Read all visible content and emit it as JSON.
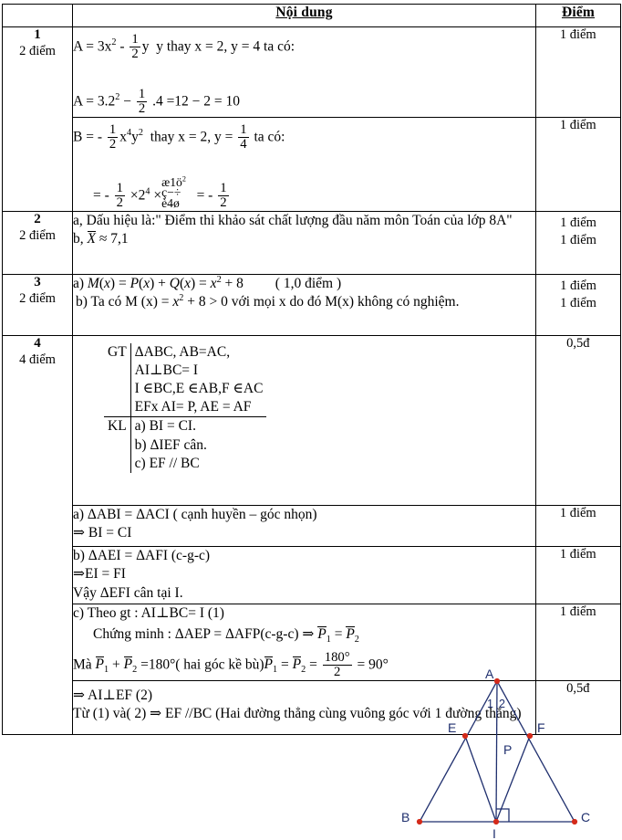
{
  "header": {
    "col_no": "",
    "col_content": "Nội dung",
    "col_points": "Điểm"
  },
  "rows": [
    {
      "no": "1",
      "no_points": "2 điểm",
      "parts": [
        {
          "lines": [
            "A = 3x² - ½ y  thay x = 2, y = 4 ta có:",
            "A = 3.2² − ½ .4 = 12 − 2 = 10"
          ],
          "points": "1 điểm"
        },
        {
          "lines": [
            "B = - ½ x⁴y²  thay x = 2, y = ¼ ta có:",
            "= - ½ ×2⁴ × (1/4)² = - ½"
          ],
          "points": "1 điểm"
        }
      ]
    },
    {
      "no": "2",
      "no_points": "2 điểm",
      "lines": [
        "a, Dấu hiệu là:\" Điểm thi khảo sát chất lượng đầu năm môn Toán của lớp 8A\"",
        "b, X̄ ≈ 7,1"
      ],
      "points": [
        "1 điểm",
        "1 điểm"
      ]
    },
    {
      "no": "3",
      "no_points": "2 điểm",
      "lines": [
        "a) M(x) = P(x) + Q(x) = x² + 8        ( 1,0 điểm )",
        "b) Ta có M (x) = x² + 8 > 0  với mọi x do đó M(x) không có nghiệm."
      ],
      "points": [
        "1 điểm",
        "1 điểm"
      ]
    },
    {
      "no": "4",
      "no_points": "4 điểm",
      "gtkl": {
        "gt_label": "GT",
        "kl_label": "KL",
        "gt_lines": [
          "ΔABC, AB=AC,",
          "AI⊥BC= I",
          "I ∈BC,E ∈AB,F ∈AC",
          "EFx AI= P, AE = AF"
        ],
        "kl_lines": [
          "a) BI = CI.",
          "b) ΔIEF cân.",
          "c) EF // BC"
        ]
      },
      "figure": {
        "labels": {
          "A": "A",
          "B": "B",
          "C": "C",
          "E": "E",
          "F": "F",
          "I": "I",
          "P": "P",
          "angle1": "1",
          "angle2": "2"
        },
        "line_color": "#1f2f6e",
        "point_color": "#d42a1a"
      },
      "figure_points": "0,5đ",
      "parts": [
        {
          "lines": [
            "a) ΔABI = ΔACI ( cạnh huyền – góc nhọn)",
            "⇒ BI = CI"
          ],
          "points": "1 điểm"
        },
        {
          "lines": [
            "b) ΔAEI = ΔAFI (c-g-c)",
            "⇒EI = FI",
            "Vậy ΔEFI cân tại I."
          ],
          "points": "1 điểm"
        },
        {
          "lines": [
            "c) Theo gt : AI⊥BC= I  (1)",
            "Chứng minh : ΔAEP = ΔAFP(c-g-c) ⇒ P̄₁ = P̄₂",
            "Mà P̄₁ + P̄₂ =180°( hai góc kề bù)P̄₁ = P̄₂ = 180°/2 = 90°"
          ],
          "points": "1 điểm"
        },
        {
          "lines": [
            "⇒ AI⊥EF (2)",
            "Từ (1) và( 2) ⇒ EF //BC (Hai đường thẳng cùng vuông góc với 1 đường thẳng)"
          ],
          "points": "0,5đ"
        }
      ]
    }
  ],
  "text": {
    "r1_a_lead": "A = 3x",
    "r1_a_mid": "y  thay x = 2, y = 4 ta có:",
    "r1_a2_lead": "A = 3.2",
    "r1_a2_mid": ".4  =12 − 2 = 10",
    "r1_b_lead": "B  = -",
    "r1_b_mid": "thay x = 2, y =",
    "r1_b_tail": "ta có:",
    "r1_b2_eq": "= -",
    "r1_b2_mul": "×2",
    "r1_b2_mul2": "×",
    "r1_b2_res": "= -",
    "r2_a": "a, Dấu hiệu là:\" Điểm thi khảo sát chất lượng đầu năm môn Toán của lớp 8A\"",
    "r2_b_lead": "b,",
    "r2_b_val": "≈ 7,1",
    "r3_a_pre": "a) ",
    "r3_a_note": "( 1,0 điểm )",
    "r3_b_pre": "b) Ta có M (x) = ",
    "r3_b_post": " > 0  với mọi x do đó M(x) không có nghiệm.",
    "r4a_1": "a) ΔABI = ΔACI ( cạnh huyền – góc nhọn)",
    "r4a_2": "⇒ BI = CI",
    "r4b_1": "b) ΔAEI = ΔAFI (c-g-c)",
    "r4b_2": "⇒EI = FI",
    "r4b_3": "Vậy ΔEFI cân tại I.",
    "r4c_1": "c) Theo gt : AI⊥BC= I  (1)",
    "r4c_2a": "Chứng minh : ΔAEP = ΔAFP(c-g-c)  ⇒",
    "r4c_3a": "Mà",
    "r4c_3b": "=180°( hai góc kề bù)",
    "r4c_3c": "=",
    "r4c_3d": "= 90°",
    "r4d_1": "⇒  AI⊥EF (2)",
    "r4d_2": "Từ (1) và( 2) ⇒ EF //BC (Hai đường thẳng cùng vuông góc với 1 đường thẳng)"
  }
}
